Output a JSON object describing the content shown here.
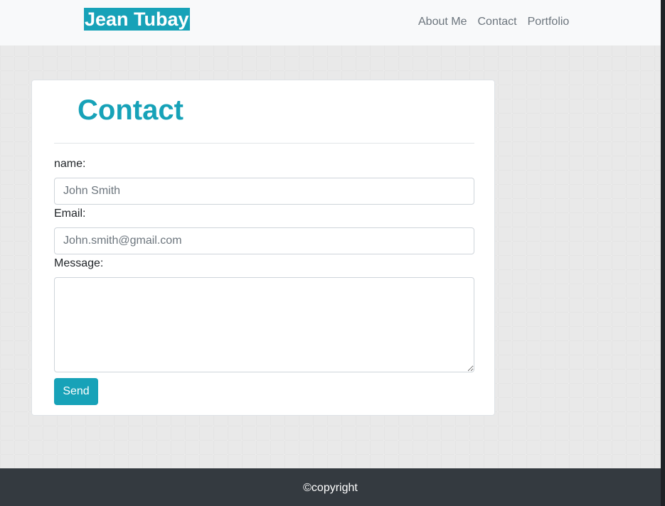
{
  "navbar": {
    "brand": "Jean Tubay",
    "links": [
      {
        "label": "About Me"
      },
      {
        "label": "Contact"
      },
      {
        "label": "Portfolio"
      }
    ]
  },
  "contact_card": {
    "title": "Contact",
    "fields": {
      "name": {
        "label": "name:",
        "placeholder": "John Smith"
      },
      "email": {
        "label": "Email:",
        "placeholder": "John.smith@gmail.com"
      },
      "message": {
        "label": "Message:",
        "value": ""
      }
    },
    "send_label": "Send"
  },
  "footer": {
    "text": "©copyright"
  },
  "colors": {
    "accent": "#17a2b8",
    "navbar_bg": "#f8f9fa",
    "footer_bg": "#343a40",
    "nav_link": "#6c757d"
  }
}
